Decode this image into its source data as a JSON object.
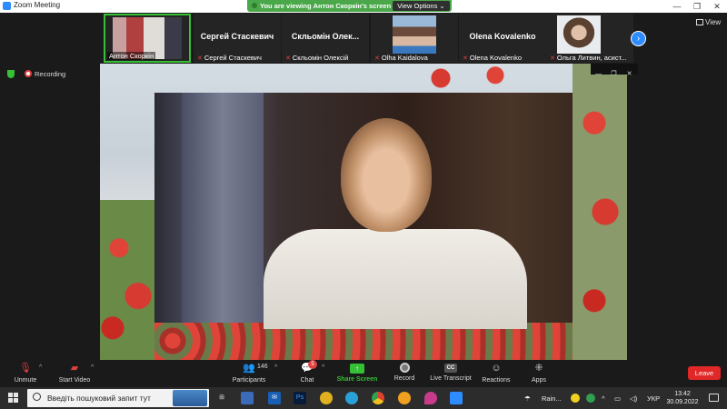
{
  "titlebar": {
    "title": "Zoom Meeting",
    "minimize": "—",
    "maximize": "❐",
    "close": "✕"
  },
  "share_banner": {
    "text": "You are viewing Антон Скоркін's screen",
    "view_options": "View Options ⌄"
  },
  "participants_strip": [
    {
      "label": "Антон Скоркін",
      "muted": false,
      "has_video": true
    },
    {
      "name": "Сергей Стаскевич",
      "label": "Сергей Стаскевич",
      "muted": true,
      "has_video": false
    },
    {
      "name": "Скльомін Олек...",
      "label": "Скльомін Олексій",
      "muted": true,
      "has_video": false
    },
    {
      "label": "Olha Kaidalova",
      "muted": true,
      "has_video": true
    },
    {
      "name": "Olena Kovalenko",
      "label": "Olena Kovalenko",
      "muted": true,
      "has_video": false
    },
    {
      "label": "Ольга Литвин, асист...",
      "muted": true,
      "has_video": true
    }
  ],
  "view_button": "View",
  "next_arrow": "›",
  "status": {
    "recording": "Recording"
  },
  "mini_controls": [
    "—",
    "❐",
    "✕"
  ],
  "toolbar": {
    "unmute": "Unmute",
    "start_video": "Start Video",
    "participants": "Participants",
    "participants_count": "146",
    "chat": "Chat",
    "chat_badge": "5",
    "share_screen": "Share Screen",
    "record": "Record",
    "live_transcript": "Live Transcript",
    "cc": "CC",
    "reactions": "Reactions",
    "apps": "Apps",
    "leave": "Leave",
    "caret": "^"
  },
  "taskbar": {
    "search_placeholder": "Введіть пошуковий запит тут",
    "apps": [
      {
        "icon": "task-view-icon",
        "text": "⊞"
      },
      {
        "icon": "store-icon",
        "text": ""
      },
      {
        "icon": "mail-icon",
        "text": "✉"
      },
      {
        "icon": "photoshop-icon",
        "text": "Ps"
      },
      {
        "icon": "chrome-alt-icon",
        "text": ""
      },
      {
        "icon": "edge-icon",
        "text": ""
      },
      {
        "icon": "chrome-icon",
        "text": ""
      },
      {
        "icon": "paint-icon",
        "text": ""
      },
      {
        "icon": "droplet-icon",
        "text": ""
      },
      {
        "icon": "zoom-icon",
        "text": ""
      }
    ],
    "weather": "Rain...",
    "language": "УКР",
    "time": "13:42",
    "date": "30.09.2022"
  }
}
